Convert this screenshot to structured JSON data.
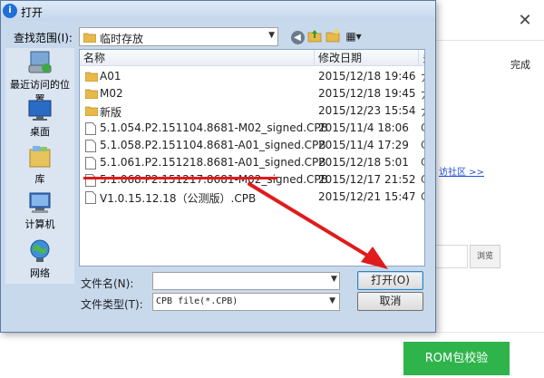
{
  "background_app": {
    "close_glyph": "✕",
    "done_text": "完成",
    "link_text": "访社区 >>",
    "browse_label": "浏览",
    "rom_button_label": "ROM包校验",
    "accent_green": "#2fb44c"
  },
  "dialog": {
    "title": "打开",
    "app_icon_glyph": "i",
    "look_in_label": "查找范围(I):",
    "look_in_value": "临时存放",
    "view_menu_glyph": "▦▾",
    "places": [
      {
        "label": "最近访问的位置",
        "icon": "recent-places-icon"
      },
      {
        "label": "桌面",
        "icon": "desktop-icon"
      },
      {
        "label": "库",
        "icon": "libraries-icon"
      },
      {
        "label": "计算机",
        "icon": "computer-icon"
      },
      {
        "label": "网络",
        "icon": "network-icon"
      }
    ],
    "columns": {
      "name": "名称",
      "date": "修改日期",
      "extra": "多"
    },
    "files": [
      {
        "name": "A01",
        "date": "2015/12/18 19:46",
        "type": "folder",
        "extra": "ﾌ"
      },
      {
        "name": "M02",
        "date": "2015/12/18 19:45",
        "type": "folder",
        "extra": "ﾌ"
      },
      {
        "name": "新版",
        "date": "2015/12/23 15:54",
        "type": "folder",
        "extra": "ﾌ"
      },
      {
        "name": "5.1.054.P2.151104.8681-M02_signed.CPB",
        "date": "2015/11/4 18:06",
        "type": "file",
        "extra": "C"
      },
      {
        "name": "5.1.058.P2.151104.8681-A01_signed.CPB",
        "date": "2015/11/4 17:29",
        "type": "file",
        "extra": "C"
      },
      {
        "name": "5.1.061.P2.151218.8681-A01_signed.CPB",
        "date": "2015/12/18 5:01",
        "type": "file",
        "extra": "C"
      },
      {
        "name": "5.1.068.P2.151217.8681-M02_signed.CPB",
        "date": "2015/12/17 21:52",
        "type": "file",
        "extra": "C"
      },
      {
        "name": "V1.0.15.12.18（公测版）.CPB",
        "date": "2015/12/21 15:47",
        "type": "file",
        "extra": "C"
      }
    ],
    "file_name_label": "文件名(N):",
    "file_name_value": "",
    "file_type_label": "文件类型(T):",
    "file_type_value": "CPB file(*.CPB)",
    "open_label": "打开(O)",
    "cancel_label": "取消"
  },
  "colors": {
    "annotation_red": "#e01b1b",
    "dialog_frame": "#c9d9ec"
  }
}
